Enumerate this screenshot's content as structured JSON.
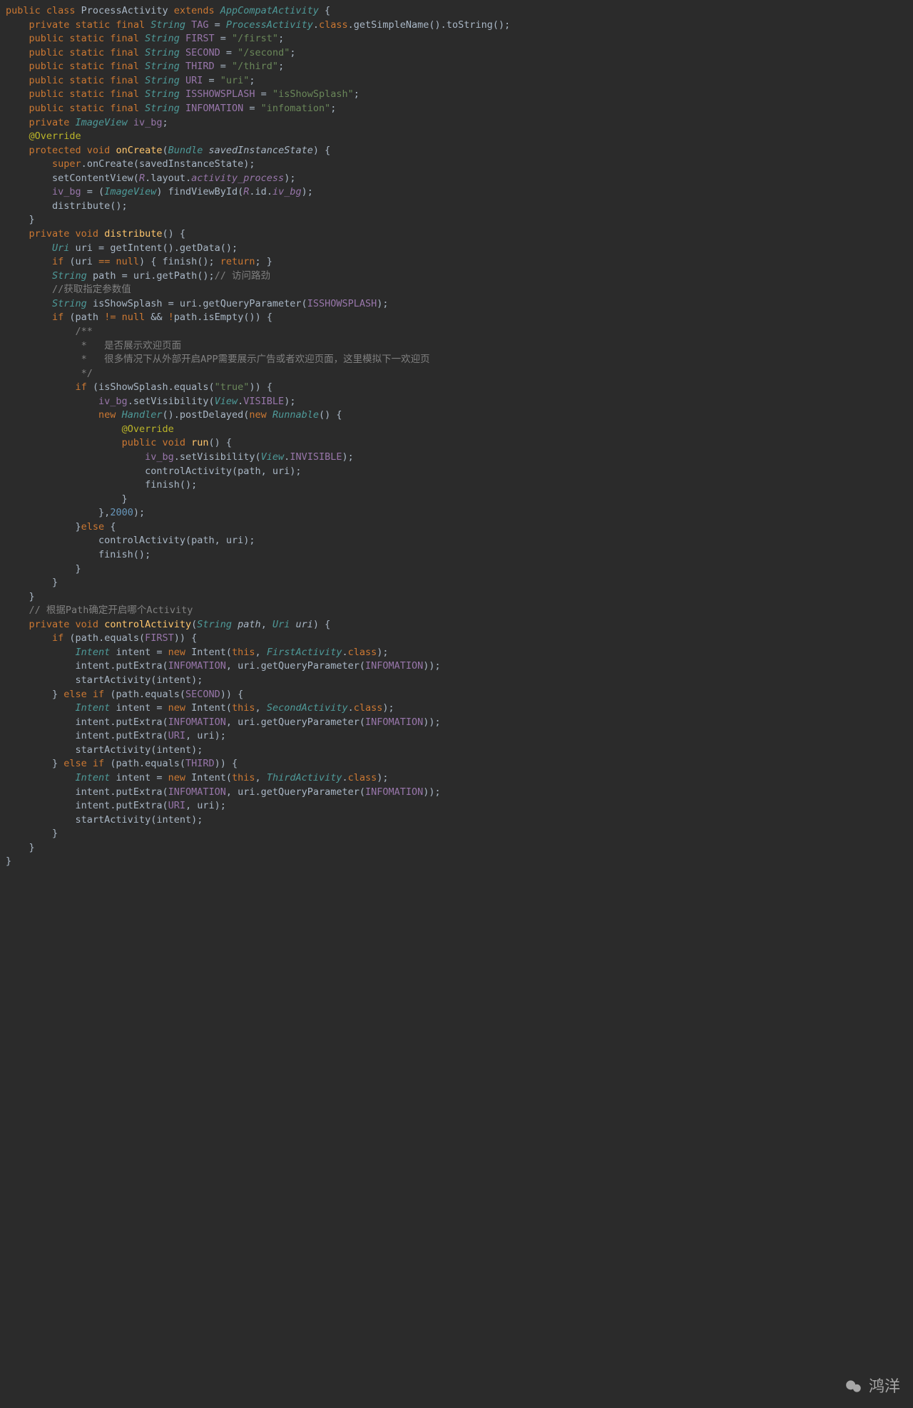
{
  "watermark": "鸿洋",
  "code_lines": [
    [
      [
        "kw",
        "public class "
      ],
      [
        "op",
        "ProcessActivity "
      ],
      [
        "kw",
        "extends "
      ],
      [
        "type",
        "AppCompatActivity"
      ],
      [
        "op",
        " {"
      ]
    ],
    [
      [
        "op",
        "    "
      ],
      [
        "kw",
        "private static final "
      ],
      [
        "type",
        "String"
      ],
      [
        "op",
        " "
      ],
      [
        "field",
        "TAG"
      ],
      [
        "op",
        " = "
      ],
      [
        "type",
        "ProcessActivity"
      ],
      [
        "dot",
        "."
      ],
      [
        "kw",
        "class"
      ],
      [
        "dot",
        "."
      ],
      [
        "op",
        "getSimpleName()"
      ],
      [
        "dot",
        "."
      ],
      [
        "op",
        "toString();"
      ]
    ],
    [
      [
        "op",
        "    "
      ],
      [
        "kw",
        "public static final "
      ],
      [
        "type",
        "String"
      ],
      [
        "op",
        " "
      ],
      [
        "field",
        "FIRST"
      ],
      [
        "op",
        " = "
      ],
      [
        "str",
        "\"/first\""
      ],
      [
        "op",
        ";"
      ]
    ],
    [
      [
        "op",
        "    "
      ],
      [
        "kw",
        "public static final "
      ],
      [
        "type",
        "String"
      ],
      [
        "op",
        " "
      ],
      [
        "field",
        "SECOND"
      ],
      [
        "op",
        " = "
      ],
      [
        "str",
        "\"/second\""
      ],
      [
        "op",
        ";"
      ]
    ],
    [
      [
        "op",
        "    "
      ],
      [
        "kw",
        "public static final "
      ],
      [
        "type",
        "String"
      ],
      [
        "op",
        " "
      ],
      [
        "field",
        "THIRD"
      ],
      [
        "op",
        " = "
      ],
      [
        "str",
        "\"/third\""
      ],
      [
        "op",
        ";"
      ]
    ],
    [
      [
        "op",
        "    "
      ],
      [
        "kw",
        "public static final "
      ],
      [
        "type",
        "String"
      ],
      [
        "op",
        " "
      ],
      [
        "field",
        "URI"
      ],
      [
        "op",
        " = "
      ],
      [
        "str",
        "\"uri\""
      ],
      [
        "op",
        ";"
      ]
    ],
    [
      [
        "op",
        "    "
      ],
      [
        "kw",
        "public static final "
      ],
      [
        "type",
        "String"
      ],
      [
        "op",
        " "
      ],
      [
        "field",
        "ISSHOWSPLASH"
      ],
      [
        "op",
        " = "
      ],
      [
        "str",
        "\"isShowSplash\""
      ],
      [
        "op",
        ";"
      ]
    ],
    [
      [
        "op",
        "    "
      ],
      [
        "kw",
        "public static final "
      ],
      [
        "type",
        "String"
      ],
      [
        "op",
        " "
      ],
      [
        "field",
        "INFOMATION"
      ],
      [
        "op",
        " = "
      ],
      [
        "str",
        "\"infomation\""
      ],
      [
        "op",
        ";"
      ]
    ],
    [
      [
        "op",
        "    "
      ],
      [
        "kw",
        "private "
      ],
      [
        "type",
        "ImageView"
      ],
      [
        "op",
        " "
      ],
      [
        "field",
        "iv_bg"
      ],
      [
        "op",
        ";"
      ]
    ],
    [
      [
        "op",
        ""
      ]
    ],
    [
      [
        "op",
        "    "
      ],
      [
        "ann",
        "@Override"
      ]
    ],
    [
      [
        "op",
        "    "
      ],
      [
        "kw",
        "protected void "
      ],
      [
        "fn",
        "onCreate"
      ],
      [
        "op",
        "("
      ],
      [
        "type",
        "Bundle"
      ],
      [
        "op",
        " "
      ],
      [
        "param",
        "savedInstanceState"
      ],
      [
        "op",
        ") {"
      ]
    ],
    [
      [
        "op",
        "        "
      ],
      [
        "kw",
        "super"
      ],
      [
        "dot",
        "."
      ],
      [
        "op",
        "onCreate(savedInstanceState);"
      ]
    ],
    [
      [
        "op",
        "        setContentView("
      ],
      [
        "purple",
        "R"
      ],
      [
        "dot",
        "."
      ],
      [
        "op",
        "layout"
      ],
      [
        "dot",
        "."
      ],
      [
        "purple",
        "activity_process"
      ],
      [
        "op",
        ");"
      ]
    ],
    [
      [
        "op",
        ""
      ]
    ],
    [
      [
        "op",
        "        "
      ],
      [
        "field",
        "iv_bg"
      ],
      [
        "op",
        " = ("
      ],
      [
        "type",
        "ImageView"
      ],
      [
        "op",
        ") findViewById("
      ],
      [
        "purple",
        "R"
      ],
      [
        "dot",
        "."
      ],
      [
        "op",
        "id"
      ],
      [
        "dot",
        "."
      ],
      [
        "purple",
        "iv_bg"
      ],
      [
        "op",
        ");"
      ]
    ],
    [
      [
        "op",
        ""
      ]
    ],
    [
      [
        "op",
        "        distribute();"
      ]
    ],
    [
      [
        "op",
        "    }"
      ]
    ],
    [
      [
        "op",
        ""
      ]
    ],
    [
      [
        "op",
        "    "
      ],
      [
        "kw",
        "private void "
      ],
      [
        "fn",
        "distribute"
      ],
      [
        "op",
        "() {"
      ]
    ],
    [
      [
        "op",
        "        "
      ],
      [
        "type",
        "Uri"
      ],
      [
        "op",
        " uri = getIntent()"
      ],
      [
        "dot",
        "."
      ],
      [
        "op",
        "getData();"
      ]
    ],
    [
      [
        "op",
        "        "
      ],
      [
        "kw",
        "if "
      ],
      [
        "op",
        "(uri "
      ],
      [
        "kw",
        "== null"
      ],
      [
        "op",
        ") { finish(); "
      ],
      [
        "kw",
        "return"
      ],
      [
        "op",
        "; }"
      ]
    ],
    [
      [
        "op",
        ""
      ]
    ],
    [
      [
        "op",
        "        "
      ],
      [
        "type",
        "String"
      ],
      [
        "op",
        " path = uri"
      ],
      [
        "dot",
        "."
      ],
      [
        "op",
        "getPath();"
      ],
      [
        "cmt",
        "// 访问路劲"
      ]
    ],
    [
      [
        "op",
        "        "
      ],
      [
        "cmt",
        "//获取指定参数值"
      ]
    ],
    [
      [
        "op",
        "        "
      ],
      [
        "type",
        "String"
      ],
      [
        "op",
        " isShowSplash = uri"
      ],
      [
        "dot",
        "."
      ],
      [
        "op",
        "getQueryParameter("
      ],
      [
        "field",
        "ISSHOWSPLASH"
      ],
      [
        "op",
        ");"
      ]
    ],
    [
      [
        "op",
        ""
      ]
    ],
    [
      [
        "op",
        "        "
      ],
      [
        "kw",
        "if "
      ],
      [
        "op",
        "(path "
      ],
      [
        "kw",
        "!= null "
      ],
      [
        "op",
        "&& "
      ],
      [
        "kw",
        "!"
      ],
      [
        "op",
        "path"
      ],
      [
        "dot",
        "."
      ],
      [
        "op",
        "isEmpty()) {"
      ]
    ],
    [
      [
        "op",
        "            "
      ],
      [
        "cmt",
        "/**"
      ]
    ],
    [
      [
        "op",
        "            "
      ],
      [
        "cmt",
        " *   是否展示欢迎页面"
      ]
    ],
    [
      [
        "op",
        "            "
      ],
      [
        "cmt",
        " *   很多情况下从外部开启APP需要展示广告或者欢迎页面，这里模拟下一欢迎页"
      ]
    ],
    [
      [
        "op",
        "            "
      ],
      [
        "cmt",
        " */"
      ]
    ],
    [
      [
        "op",
        "            "
      ],
      [
        "kw",
        "if "
      ],
      [
        "op",
        "(isShowSplash"
      ],
      [
        "dot",
        "."
      ],
      [
        "op",
        "equals("
      ],
      [
        "str",
        "\"true\""
      ],
      [
        "op",
        ")) {"
      ]
    ],
    [
      [
        "op",
        "                "
      ],
      [
        "field",
        "iv_bg"
      ],
      [
        "dot",
        "."
      ],
      [
        "op",
        "setVisibility("
      ],
      [
        "type",
        "View"
      ],
      [
        "dot",
        "."
      ],
      [
        "field",
        "VISIBLE"
      ],
      [
        "op",
        ");"
      ]
    ],
    [
      [
        "op",
        "                "
      ],
      [
        "kw",
        "new "
      ],
      [
        "type",
        "Handler"
      ],
      [
        "op",
        "()"
      ],
      [
        "dot",
        "."
      ],
      [
        "op",
        "postDelayed("
      ],
      [
        "kw",
        "new "
      ],
      [
        "type",
        "Runnable"
      ],
      [
        "op",
        "() {"
      ]
    ],
    [
      [
        "op",
        "                    "
      ],
      [
        "ann",
        "@Override"
      ]
    ],
    [
      [
        "op",
        "                    "
      ],
      [
        "kw",
        "public void "
      ],
      [
        "fn",
        "run"
      ],
      [
        "op",
        "() {"
      ]
    ],
    [
      [
        "op",
        "                        "
      ],
      [
        "field",
        "iv_bg"
      ],
      [
        "dot",
        "."
      ],
      [
        "op",
        "setVisibility("
      ],
      [
        "type",
        "View"
      ],
      [
        "dot",
        "."
      ],
      [
        "field",
        "INVISIBLE"
      ],
      [
        "op",
        ");"
      ]
    ],
    [
      [
        "op",
        "                        controlActivity(path, uri);"
      ]
    ],
    [
      [
        "op",
        "                        finish();"
      ]
    ],
    [
      [
        "op",
        "                    }"
      ]
    ],
    [
      [
        "op",
        "                },"
      ],
      [
        "num",
        "2000"
      ],
      [
        "op",
        ");"
      ]
    ],
    [
      [
        "op",
        "            }"
      ],
      [
        "kw",
        "else "
      ],
      [
        "op",
        "{"
      ]
    ],
    [
      [
        "op",
        "                controlActivity(path, uri);"
      ]
    ],
    [
      [
        "op",
        "                finish();"
      ]
    ],
    [
      [
        "op",
        "            }"
      ]
    ],
    [
      [
        "op",
        "        }"
      ]
    ],
    [
      [
        "op",
        ""
      ]
    ],
    [
      [
        "op",
        "    }"
      ]
    ],
    [
      [
        "op",
        "    "
      ],
      [
        "cmt",
        "// 根据Path确定开启哪个Activity"
      ]
    ],
    [
      [
        "op",
        "    "
      ],
      [
        "kw",
        "private void "
      ],
      [
        "fn",
        "controlActivity"
      ],
      [
        "op",
        "("
      ],
      [
        "type",
        "String"
      ],
      [
        "op",
        " "
      ],
      [
        "param",
        "path"
      ],
      [
        "op",
        ", "
      ],
      [
        "type",
        "Uri"
      ],
      [
        "op",
        " "
      ],
      [
        "param",
        "uri"
      ],
      [
        "op",
        ") {"
      ]
    ],
    [
      [
        "op",
        "        "
      ],
      [
        "kw",
        "if "
      ],
      [
        "op",
        "(path"
      ],
      [
        "dot",
        "."
      ],
      [
        "op",
        "equals("
      ],
      [
        "field",
        "FIRST"
      ],
      [
        "op",
        ")) {"
      ]
    ],
    [
      [
        "op",
        "            "
      ],
      [
        "type",
        "Intent"
      ],
      [
        "op",
        " intent = "
      ],
      [
        "kw",
        "new "
      ],
      [
        "op",
        "Intent("
      ],
      [
        "kw",
        "this"
      ],
      [
        "op",
        ", "
      ],
      [
        "type",
        "FirstActivity"
      ],
      [
        "dot",
        "."
      ],
      [
        "kw",
        "class"
      ],
      [
        "op",
        ");"
      ]
    ],
    [
      [
        "op",
        "            intent"
      ],
      [
        "dot",
        "."
      ],
      [
        "op",
        "putExtra("
      ],
      [
        "field",
        "INFOMATION"
      ],
      [
        "op",
        ", uri"
      ],
      [
        "dot",
        "."
      ],
      [
        "op",
        "getQueryParameter("
      ],
      [
        "field",
        "INFOMATION"
      ],
      [
        "op",
        "));"
      ]
    ],
    [
      [
        "op",
        "            startActivity(intent);"
      ]
    ],
    [
      [
        "op",
        "        } "
      ],
      [
        "kw",
        "else if "
      ],
      [
        "op",
        "(path"
      ],
      [
        "dot",
        "."
      ],
      [
        "op",
        "equals("
      ],
      [
        "field",
        "SECOND"
      ],
      [
        "op",
        ")) {"
      ]
    ],
    [
      [
        "op",
        "            "
      ],
      [
        "type",
        "Intent"
      ],
      [
        "op",
        " intent = "
      ],
      [
        "kw",
        "new "
      ],
      [
        "op",
        "Intent("
      ],
      [
        "kw",
        "this"
      ],
      [
        "op",
        ", "
      ],
      [
        "type",
        "SecondActivity"
      ],
      [
        "dot",
        "."
      ],
      [
        "kw",
        "class"
      ],
      [
        "op",
        ");"
      ]
    ],
    [
      [
        "op",
        "            intent"
      ],
      [
        "dot",
        "."
      ],
      [
        "op",
        "putExtra("
      ],
      [
        "field",
        "INFOMATION"
      ],
      [
        "op",
        ", uri"
      ],
      [
        "dot",
        "."
      ],
      [
        "op",
        "getQueryParameter("
      ],
      [
        "field",
        "INFOMATION"
      ],
      [
        "op",
        "));"
      ]
    ],
    [
      [
        "op",
        "            intent"
      ],
      [
        "dot",
        "."
      ],
      [
        "op",
        "putExtra("
      ],
      [
        "field",
        "URI"
      ],
      [
        "op",
        ", uri);"
      ]
    ],
    [
      [
        "op",
        "            startActivity(intent);"
      ]
    ],
    [
      [
        "op",
        "        } "
      ],
      [
        "kw",
        "else if "
      ],
      [
        "op",
        "(path"
      ],
      [
        "dot",
        "."
      ],
      [
        "op",
        "equals("
      ],
      [
        "field",
        "THIRD"
      ],
      [
        "op",
        ")) {"
      ]
    ],
    [
      [
        "op",
        "            "
      ],
      [
        "type",
        "Intent"
      ],
      [
        "op",
        " intent = "
      ],
      [
        "kw",
        "new "
      ],
      [
        "op",
        "Intent("
      ],
      [
        "kw",
        "this"
      ],
      [
        "op",
        ", "
      ],
      [
        "type",
        "ThirdActivity"
      ],
      [
        "dot",
        "."
      ],
      [
        "kw",
        "class"
      ],
      [
        "op",
        ");"
      ]
    ],
    [
      [
        "op",
        "            intent"
      ],
      [
        "dot",
        "."
      ],
      [
        "op",
        "putExtra("
      ],
      [
        "field",
        "INFOMATION"
      ],
      [
        "op",
        ", uri"
      ],
      [
        "dot",
        "."
      ],
      [
        "op",
        "getQueryParameter("
      ],
      [
        "field",
        "INFOMATION"
      ],
      [
        "op",
        "));"
      ]
    ],
    [
      [
        "op",
        "            intent"
      ],
      [
        "dot",
        "."
      ],
      [
        "op",
        "putExtra("
      ],
      [
        "field",
        "URI"
      ],
      [
        "op",
        ", uri);"
      ]
    ],
    [
      [
        "op",
        "            startActivity(intent);"
      ]
    ],
    [
      [
        "op",
        "        }"
      ]
    ],
    [
      [
        "op",
        ""
      ]
    ],
    [
      [
        "op",
        "    }"
      ]
    ],
    [
      [
        "op",
        ""
      ]
    ],
    [
      [
        "op",
        "}"
      ]
    ]
  ]
}
